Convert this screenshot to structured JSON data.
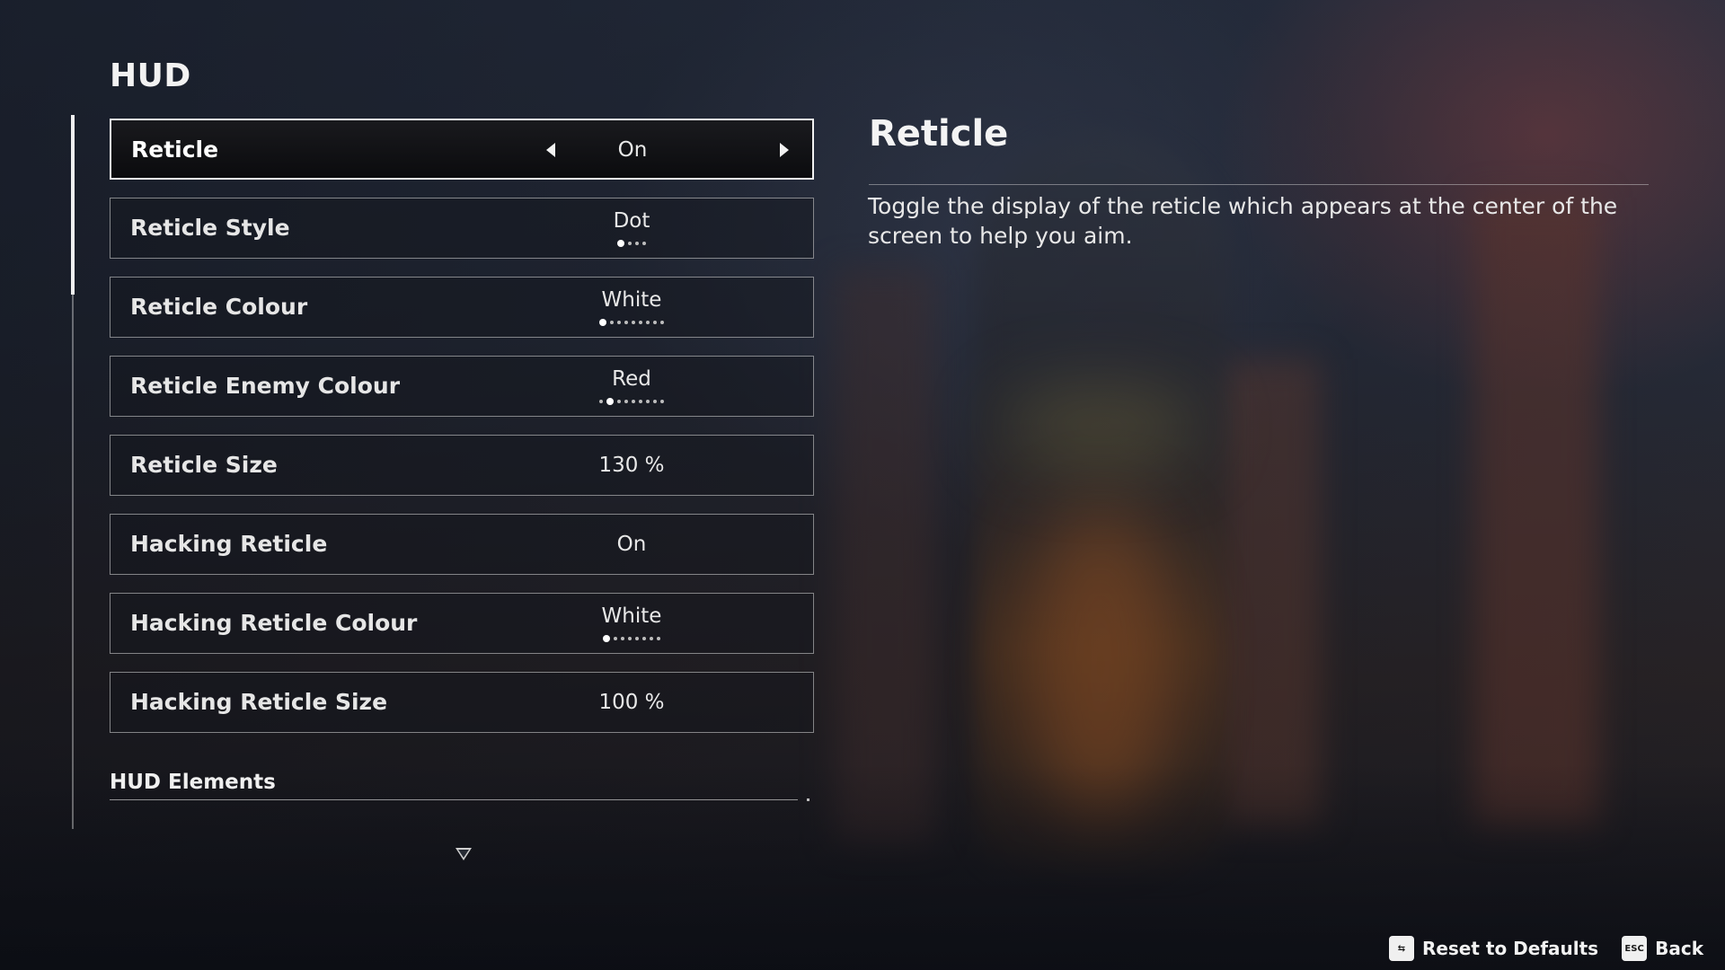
{
  "section": {
    "title": "HUD"
  },
  "settings": [
    {
      "label": "Reticle",
      "value": "On",
      "selected": true
    },
    {
      "label": "Reticle Style",
      "value": "Dot",
      "options_count": 4,
      "selected_index": 0
    },
    {
      "label": "Reticle Colour",
      "value": "White",
      "options_count": 9,
      "selected_index": 0
    },
    {
      "label": "Reticle Enemy Colour",
      "value": "Red",
      "options_count": 9,
      "selected_index": 1
    },
    {
      "label": "Reticle Size",
      "value": "130 %"
    },
    {
      "label": "Hacking Reticle",
      "value": "On"
    },
    {
      "label": "Hacking Reticle Colour",
      "value": "White",
      "options_count": 8,
      "selected_index": 0
    },
    {
      "label": "Hacking Reticle Size",
      "value": "100 %"
    }
  ],
  "subsection": {
    "title": "HUD Elements"
  },
  "detail": {
    "title": "Reticle",
    "description": "Toggle the display of the reticle which appears at the center of the screen to help you aim."
  },
  "footer": {
    "reset_key": "⇆",
    "reset_label": "Reset to Defaults",
    "back_key": "ESC",
    "back_label": "Back"
  },
  "icons": {
    "left_arrow": "left-arrow-icon",
    "right_arrow": "right-arrow-icon",
    "scroll_down": "scroll-down-icon",
    "reset_key": "reset-key-icon",
    "esc_key": "esc-key-icon"
  }
}
